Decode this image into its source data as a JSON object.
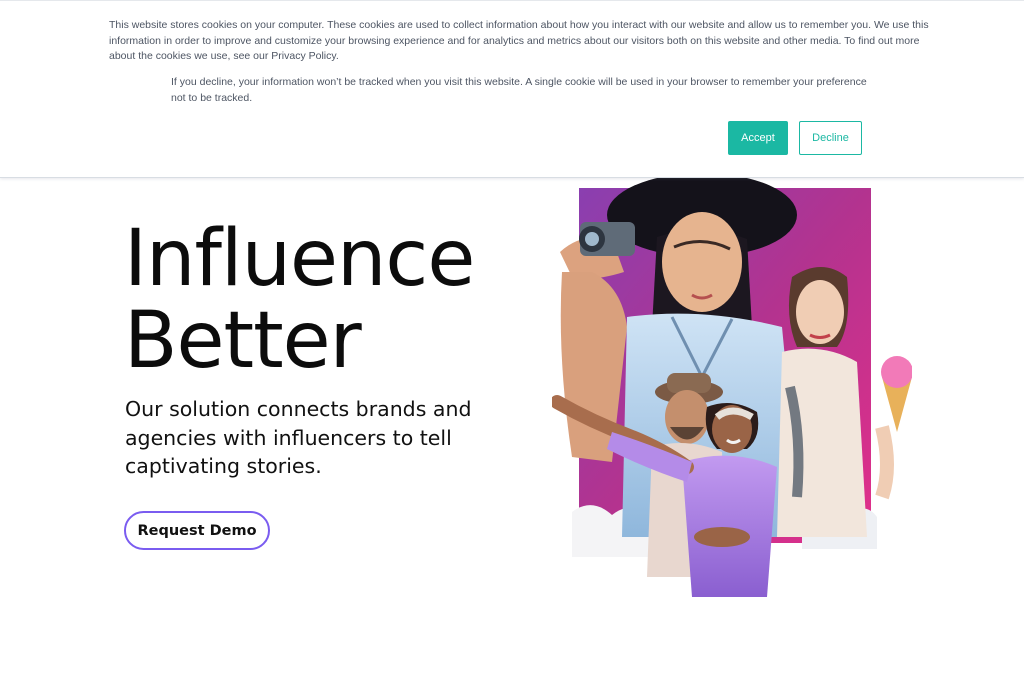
{
  "cookie_banner": {
    "text_1": "This website stores cookies on your computer. These cookies are used to collect information about how you interact with our website and allow us to remember you. We use this information in order to improve and customize your browsing experience and for analytics and metrics about our visitors both on this website and other media. To find out more about the cookies we use, see our Privacy Policy.",
    "text_2": "If you decline, your information won’t be tracked when you visit this website. A single cookie will be used in your browser to remember your preference not to be tracked.",
    "accept_label": "Accept",
    "decline_label": "Decline",
    "accent_color": "#1bb8a3"
  },
  "hero": {
    "title_line_1": "Influence",
    "title_line_2": "Better",
    "subtitle": "Our solution connects brands and agencies with influencers to tell captivating stories.",
    "cta_label": "Request Demo",
    "cta_border_color": "#7a5cf0",
    "image_subject": "influencer-collage-image"
  }
}
